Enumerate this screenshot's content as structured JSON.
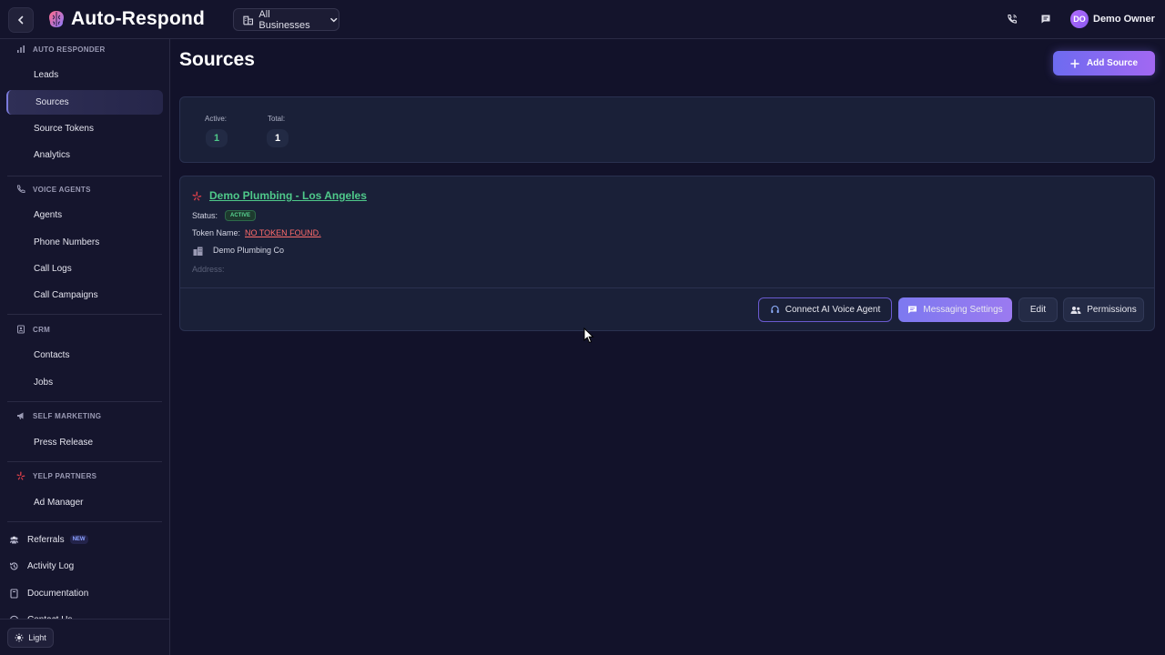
{
  "header": {
    "app_title": "Auto-Respond",
    "business_selector": "All Businesses",
    "user_initials": "DO",
    "user_name": "Demo Owner"
  },
  "sidebar": {
    "sections": [
      {
        "title": "AUTO RESPONDER",
        "icon": "bar-chart-icon",
        "items": [
          "Leads",
          "Sources",
          "Source Tokens",
          "Analytics"
        ]
      },
      {
        "title": "VOICE AGENTS",
        "icon": "phone-icon",
        "items": [
          "Agents",
          "Phone Numbers",
          "Call Logs",
          "Call Campaigns"
        ]
      },
      {
        "title": "CRM",
        "icon": "contacts-icon",
        "items": [
          "Contacts",
          "Jobs"
        ]
      },
      {
        "title": "SELF MARKETING",
        "icon": "megaphone-icon",
        "items": [
          "Press Release"
        ]
      },
      {
        "title": "YELP PARTNERS",
        "icon": "yelp-icon",
        "items": [
          "Ad Manager"
        ]
      }
    ],
    "active_item": "Sources",
    "bottom": {
      "referrals": "Referrals",
      "referrals_badge": "NEW",
      "activity_log": "Activity Log",
      "documentation": "Documentation",
      "contact_us": "Contact Us"
    },
    "theme_toggle": "Light"
  },
  "main": {
    "page_title": "Sources",
    "add_button": "Add Source",
    "stats": {
      "active_label": "Active:",
      "active_value": "1",
      "total_label": "Total:",
      "total_value": "1"
    },
    "source": {
      "name": "Demo Plumbing - Los Angeles",
      "status_label": "Status:",
      "status_value": "ACTIVE",
      "token_label": "Token Name:",
      "token_value": "NO TOKEN FOUND.",
      "business": "Demo Plumbing Co",
      "address_label": "Address:",
      "buttons": {
        "connect": "Connect AI Voice Agent",
        "messaging": "Messaging Settings",
        "edit": "Edit",
        "permissions": "Permissions"
      }
    }
  },
  "colors": {
    "accent": "#7d79f0",
    "active_green": "#4fc98a",
    "error_red": "#ff6b6b",
    "background": "#12122a"
  }
}
